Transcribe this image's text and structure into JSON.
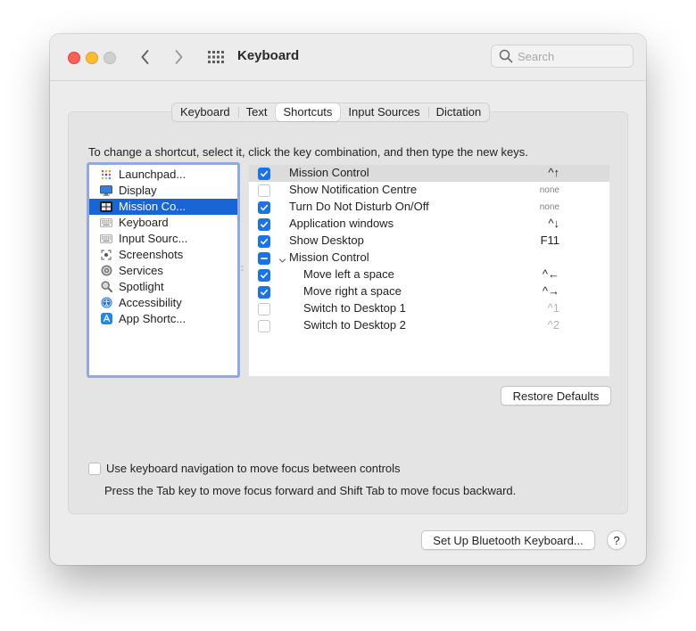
{
  "window": {
    "title": "Keyboard",
    "search_placeholder": "Search",
    "icons": [
      "close-light",
      "minimize-light",
      "zoom-light",
      "chevron-left-icon",
      "chevron-right-icon",
      "grid-icon",
      "search-icon"
    ]
  },
  "tabs": [
    {
      "label": "Keyboard",
      "active": false
    },
    {
      "label": "Text",
      "active": false
    },
    {
      "label": "Shortcuts",
      "active": true
    },
    {
      "label": "Input Sources",
      "active": false
    },
    {
      "label": "Dictation",
      "active": false
    }
  ],
  "instructions": "To change a shortcut, select it, click the key combination, and then type the new keys.",
  "categories": [
    {
      "label": "Launchpad...",
      "icon": "launchpad-icon",
      "selected": false
    },
    {
      "label": "Display",
      "icon": "display-icon",
      "selected": false
    },
    {
      "label": "Mission Co...",
      "icon": "mission-control-icon",
      "selected": true
    },
    {
      "label": "Keyboard",
      "icon": "keyboard-icon",
      "selected": false
    },
    {
      "label": "Input Sourc...",
      "icon": "input-sources-icon",
      "selected": false
    },
    {
      "label": "Screenshots",
      "icon": "screenshot-icon",
      "selected": false
    },
    {
      "label": "Services",
      "icon": "gear-icon",
      "selected": false
    },
    {
      "label": "Spotlight",
      "icon": "magnifier-icon",
      "selected": false
    },
    {
      "label": "Accessibility",
      "icon": "accessibility-icon",
      "selected": false
    },
    {
      "label": "App Shortc...",
      "icon": "app-store-icon",
      "selected": false
    }
  ],
  "shortcuts": [
    {
      "name": "Mission Control",
      "key": "^↑",
      "state": "checked",
      "level": 0,
      "highlight": true
    },
    {
      "name": "Show Notification Centre",
      "key": "none",
      "state": "unchecked",
      "level": 0
    },
    {
      "name": "Turn Do Not Disturb On/Off",
      "key": "none",
      "state": "checked",
      "level": 0
    },
    {
      "name": "Application windows",
      "key": "^↓",
      "state": "checked",
      "level": 0
    },
    {
      "name": "Show Desktop",
      "key": "F11",
      "state": "checked",
      "level": 0
    },
    {
      "name": "Mission Control",
      "key": "",
      "state": "mixed",
      "level": 0,
      "group": true
    },
    {
      "name": "Move left a space",
      "key": "^←",
      "state": "checked",
      "level": 1
    },
    {
      "name": "Move right a space",
      "key": "^→",
      "state": "checked",
      "level": 1
    },
    {
      "name": "Switch to Desktop 1",
      "key": "^1",
      "state": "unchecked",
      "level": 1
    },
    {
      "name": "Switch to Desktop 2",
      "key": "^2",
      "state": "unchecked",
      "level": 1
    }
  ],
  "buttons": {
    "restore_defaults": "Restore Defaults",
    "bluetooth_setup": "Set Up Bluetooth Keyboard...",
    "help": "?"
  },
  "keyboard_navigation": {
    "label": "Use keyboard navigation to move focus between controls",
    "checked": false,
    "hint": "Press the Tab key to move focus forward and Shift Tab to move focus backward."
  },
  "colors": {
    "accent": "#1a73e8",
    "selection": "#1a65d6",
    "focus_ring": "#8fa9e6",
    "close": "#fe5f57",
    "minimize": "#febc2e"
  }
}
